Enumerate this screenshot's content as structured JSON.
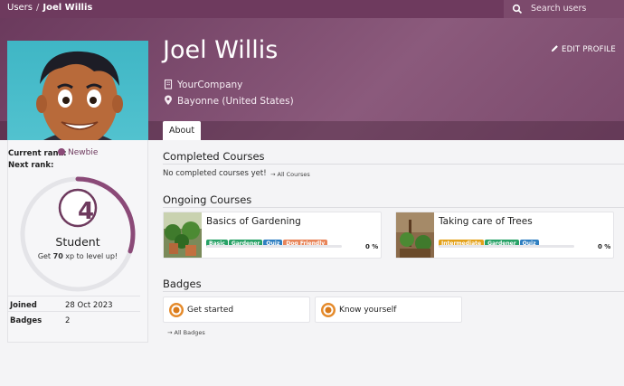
{
  "breadcrumb": {
    "root": "Users",
    "separator": "/",
    "current": "Joel Willis"
  },
  "search": {
    "placeholder": "Search users"
  },
  "profile": {
    "name": "Joel Willis",
    "company": "YourCompany",
    "location": "Bayonne (United States)",
    "edit_label": "EDIT PROFILE"
  },
  "tabs": [
    {
      "label": "About"
    }
  ],
  "sidebar": {
    "current_rank_label": "Current rank:",
    "current_rank_value": "Newbie",
    "next_rank_label": "Next rank:",
    "level_number": "4",
    "level_name": "Student",
    "xp_prefix": "Get ",
    "xp_value": "70",
    "xp_suffix": " xp to level up!",
    "progress_fraction": 0.3,
    "joined_label": "Joined",
    "joined_value": "28 Oct 2023",
    "badges_label": "Badges",
    "badges_value": "2"
  },
  "completed": {
    "heading": "Completed Courses",
    "empty": "No completed courses yet!",
    "link": "→ All Courses"
  },
  "ongoing": {
    "heading": "Ongoing Courses",
    "courses": [
      {
        "title": "Basics of Gardening",
        "tags": [
          "Basic",
          "Gardener",
          "Quiz",
          "Dog Friendly"
        ],
        "progress": "0 %"
      },
      {
        "title": "Taking care of Trees",
        "tags": [
          "Intermediate",
          "Gardener",
          "Quiz"
        ],
        "progress": "0 %"
      }
    ]
  },
  "badges": {
    "heading": "Badges",
    "items": [
      {
        "label": "Get started"
      },
      {
        "label": "Know yourself"
      }
    ],
    "link": "→ All Badges"
  },
  "colors": {
    "brand": "#6e3a5e",
    "tag_basic": "#27a166",
    "tag_gardener": "#27a166",
    "tag_quiz": "#2f7fc1",
    "tag_dog": "#e8855a",
    "tag_intermediate": "#e3a11a"
  },
  "icons": {
    "search": "search-icon",
    "company": "building-icon",
    "location": "map-pin-icon",
    "edit": "pencil-icon",
    "rank": "rank-medal-icon",
    "badge": "badge-medal-icon"
  }
}
